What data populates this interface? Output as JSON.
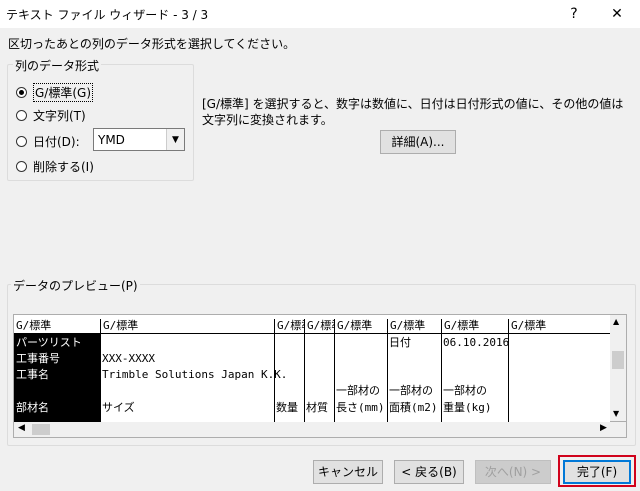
{
  "window": {
    "title": "テキスト ファイル ウィザード - 3 / 3",
    "help": "?",
    "close": "✕"
  },
  "instruction": "区切ったあとの列のデータ形式を選択してください。",
  "format_group": {
    "legend": "列のデータ形式",
    "options": [
      {
        "label": "G/標準(G)",
        "selected": true
      },
      {
        "label": "文字列(T)",
        "selected": false
      },
      {
        "label": "日付(D):",
        "selected": false
      },
      {
        "label": "削除する(I)",
        "selected": false
      }
    ],
    "date_combo_value": "YMD"
  },
  "description": "[G/標準] を選択すると、数字は数値に、日付は日付形式の値に、その他の値は文字列に変換されます。",
  "detail_button": "詳細(A)...",
  "preview": {
    "legend": "データのプレビュー(P)",
    "headers": [
      "G/標準",
      "G/標準",
      "G/標準",
      "G/標準",
      "G/標準",
      "G/標準",
      "G/標準",
      "G/標準"
    ],
    "rows": [
      [
        "パーツリスト",
        "",
        "",
        "",
        "",
        "日付",
        "06.10.2016",
        ""
      ],
      [
        "工事番号",
        "XXX-XXXX",
        "",
        "",
        "",
        "",
        "",
        ""
      ],
      [
        "工事名",
        "Trimble Solutions Japan K.K.",
        "",
        "",
        "",
        "",
        "",
        ""
      ],
      [
        "",
        "",
        "",
        "",
        "一部材の",
        "一部材の",
        "一部材の",
        ""
      ],
      [
        "部材名",
        "サイズ",
        "数量",
        "材質",
        "長さ(mm)",
        "面積(m2)",
        "重量(kg)",
        ""
      ]
    ]
  },
  "buttons": {
    "cancel": "キャンセル",
    "back": "< 戻る(B)",
    "next": "次へ(N) >",
    "finish": "完了(F)"
  }
}
